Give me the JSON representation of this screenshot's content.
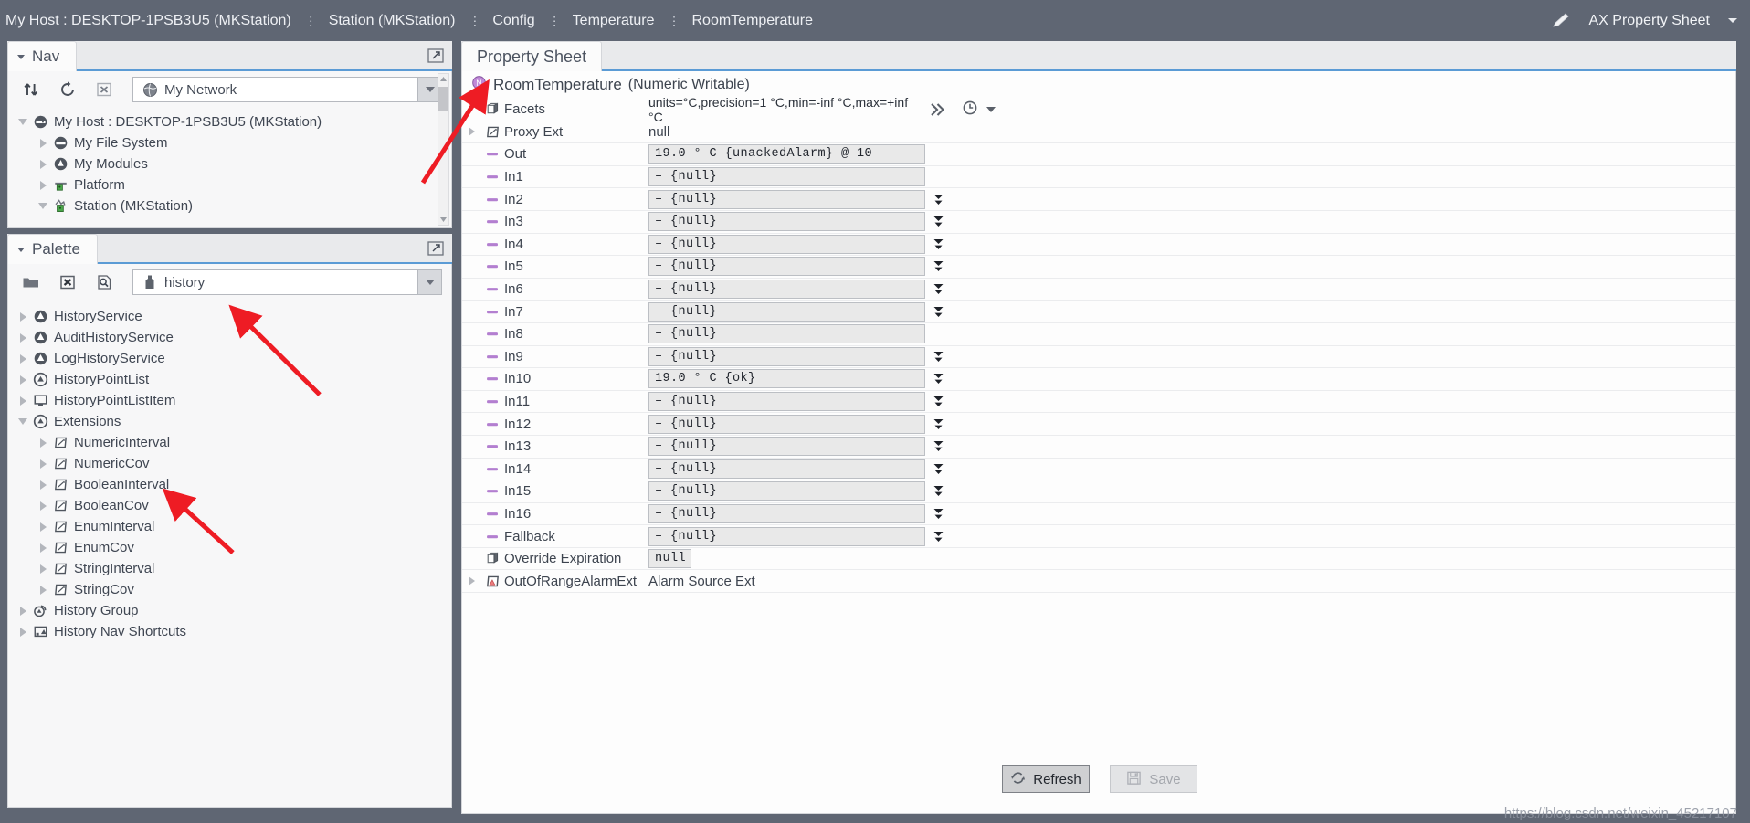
{
  "topbar": {
    "crumbs": [
      {
        "label": "My Host : DESKTOP-1PSB3U5 (MKStation)",
        "sep": ""
      },
      {
        "label": "Station (MKStation)",
        "sep": "⋮"
      },
      {
        "label": "Config",
        "sep": "⋮"
      },
      {
        "label": "Temperature",
        "sep": "⋮"
      },
      {
        "label": "RoomTemperature",
        "sep": "⋮"
      }
    ],
    "edit_icon": "pencil-icon",
    "view_selector": "AX Property Sheet"
  },
  "nav": {
    "tab_label": "Nav",
    "toolbar": {
      "sort_icon": "up-down-arrows-icon",
      "refresh_icon": "refresh-icon",
      "close_icon": "x-box-icon"
    },
    "combo_value": "My Network",
    "combo_icon": "globe-icon",
    "tree": [
      {
        "label": "My Host : DESKTOP-1PSB3U5 (MKStation)",
        "depth": 0,
        "state": "open",
        "icon": "host-icon"
      },
      {
        "label": "My File System",
        "depth": 1,
        "state": "closed",
        "icon": "filesystem-icon"
      },
      {
        "label": "My Modules",
        "depth": 1,
        "state": "closed",
        "icon": "modules-icon"
      },
      {
        "label": "Platform",
        "depth": 1,
        "state": "closed",
        "icon": "platform-icon"
      },
      {
        "label": "Station (MKStation)",
        "depth": 1,
        "state": "open",
        "icon": "station-icon"
      }
    ]
  },
  "palette": {
    "tab_label": "Palette",
    "toolbar": {
      "folder_icon": "folder-icon",
      "close_icon": "x-box-icon",
      "search_icon": "search-module-icon"
    },
    "combo_value": "history",
    "combo_icon": "module-icon",
    "tree": [
      {
        "label": "HistoryService",
        "depth": 0,
        "state": "closed",
        "icon": "history-service-icon"
      },
      {
        "label": "AuditHistoryService",
        "depth": 0,
        "state": "closed",
        "icon": "history-service-icon"
      },
      {
        "label": "LogHistoryService",
        "depth": 0,
        "state": "closed",
        "icon": "history-service-icon"
      },
      {
        "label": "HistoryPointList",
        "depth": 0,
        "state": "closed",
        "icon": "point-list-icon"
      },
      {
        "label": "HistoryPointListItem",
        "depth": 0,
        "state": "closed",
        "icon": "point-list-item-icon"
      },
      {
        "label": "Extensions",
        "depth": 0,
        "state": "open",
        "icon": "extensions-icon"
      },
      {
        "label": "NumericInterval",
        "depth": 1,
        "state": "closed",
        "icon": "extension-icon"
      },
      {
        "label": "NumericCov",
        "depth": 1,
        "state": "closed",
        "icon": "extension-icon"
      },
      {
        "label": "BooleanInterval",
        "depth": 1,
        "state": "closed",
        "icon": "extension-icon"
      },
      {
        "label": "BooleanCov",
        "depth": 1,
        "state": "closed",
        "icon": "extension-icon"
      },
      {
        "label": "EnumInterval",
        "depth": 1,
        "state": "closed",
        "icon": "extension-icon"
      },
      {
        "label": "EnumCov",
        "depth": 1,
        "state": "closed",
        "icon": "extension-icon"
      },
      {
        "label": "StringInterval",
        "depth": 1,
        "state": "closed",
        "icon": "extension-icon"
      },
      {
        "label": "StringCov",
        "depth": 1,
        "state": "closed",
        "icon": "extension-icon"
      },
      {
        "label": "History Group",
        "depth": 0,
        "state": "closed",
        "icon": "history-group-icon"
      },
      {
        "label": "History Nav Shortcuts",
        "depth": 0,
        "state": "closed",
        "icon": "history-nav-shortcuts-icon"
      }
    ]
  },
  "property_sheet": {
    "tab_label": "Property Sheet",
    "object_name": "RoomTemperature",
    "object_kind": "(Numeric Writable)",
    "object_icon": "numeric-writable-icon",
    "rows": [
      {
        "label": "Facets",
        "icon": "facets-icon",
        "twisty": "none",
        "value": "units=°C,precision=1 °C,min=-inf °C,max=+inf °C",
        "kind": "facets"
      },
      {
        "label": "Proxy Ext",
        "icon": "extension-icon",
        "twisty": "closed",
        "value": "null",
        "kind": "plain"
      },
      {
        "label": "Out",
        "icon": "slot-icon",
        "twisty": "none",
        "value": "19.0 ° C {unackedAlarm} @ 10",
        "kind": "field",
        "spinner": false
      },
      {
        "label": "In1",
        "icon": "slot-icon",
        "twisty": "none",
        "value": "– {null}",
        "kind": "field",
        "spinner": false
      },
      {
        "label": "In2",
        "icon": "slot-icon",
        "twisty": "none",
        "value": "– {null}",
        "kind": "field",
        "spinner": true
      },
      {
        "label": "In3",
        "icon": "slot-icon",
        "twisty": "none",
        "value": "– {null}",
        "kind": "field",
        "spinner": true
      },
      {
        "label": "In4",
        "icon": "slot-icon",
        "twisty": "none",
        "value": "– {null}",
        "kind": "field",
        "spinner": true
      },
      {
        "label": "In5",
        "icon": "slot-icon",
        "twisty": "none",
        "value": "– {null}",
        "kind": "field",
        "spinner": true
      },
      {
        "label": "In6",
        "icon": "slot-icon",
        "twisty": "none",
        "value": "– {null}",
        "kind": "field",
        "spinner": true
      },
      {
        "label": "In7",
        "icon": "slot-icon",
        "twisty": "none",
        "value": "– {null}",
        "kind": "field",
        "spinner": true
      },
      {
        "label": "In8",
        "icon": "slot-icon",
        "twisty": "none",
        "value": "– {null}",
        "kind": "field",
        "spinner": false
      },
      {
        "label": "In9",
        "icon": "slot-icon",
        "twisty": "none",
        "value": "– {null}",
        "kind": "field",
        "spinner": true
      },
      {
        "label": "In10",
        "icon": "slot-icon",
        "twisty": "none",
        "value": "19.0 ° C {ok}",
        "kind": "field",
        "spinner": true
      },
      {
        "label": "In11",
        "icon": "slot-icon",
        "twisty": "none",
        "value": "– {null}",
        "kind": "field",
        "spinner": true
      },
      {
        "label": "In12",
        "icon": "slot-icon",
        "twisty": "none",
        "value": "– {null}",
        "kind": "field",
        "spinner": true
      },
      {
        "label": "In13",
        "icon": "slot-icon",
        "twisty": "none",
        "value": "– {null}",
        "kind": "field",
        "spinner": true
      },
      {
        "label": "In14",
        "icon": "slot-icon",
        "twisty": "none",
        "value": "– {null}",
        "kind": "field",
        "spinner": true
      },
      {
        "label": "In15",
        "icon": "slot-icon",
        "twisty": "none",
        "value": "– {null}",
        "kind": "field",
        "spinner": true
      },
      {
        "label": "In16",
        "icon": "slot-icon",
        "twisty": "none",
        "value": "– {null}",
        "kind": "field",
        "spinner": true
      },
      {
        "label": "Fallback",
        "icon": "slot-icon",
        "twisty": "none",
        "value": "– {null}",
        "kind": "field",
        "spinner": true
      },
      {
        "label": "Override Expiration",
        "icon": "facets-icon",
        "twisty": "none",
        "value": "null",
        "kind": "field-short",
        "spinner": false
      },
      {
        "label": "OutOfRangeAlarmExt",
        "icon": "alarm-ext-icon",
        "twisty": "closed",
        "value": "Alarm Source Ext",
        "kind": "plain"
      }
    ],
    "facets_more_icon": "double-chevron-right-icon",
    "facets_history_icon": "clock-icon",
    "buttons": {
      "refresh": "Refresh",
      "save": "Save"
    }
  },
  "watermark": "https://blog.csdn.net/weixin_45217107",
  "colors": {
    "chrome": "#5f6673",
    "accent_tab_underline": "#5b9bd5",
    "slot_purple": "#b37fd0",
    "arrow_red": "#ee1c24"
  }
}
